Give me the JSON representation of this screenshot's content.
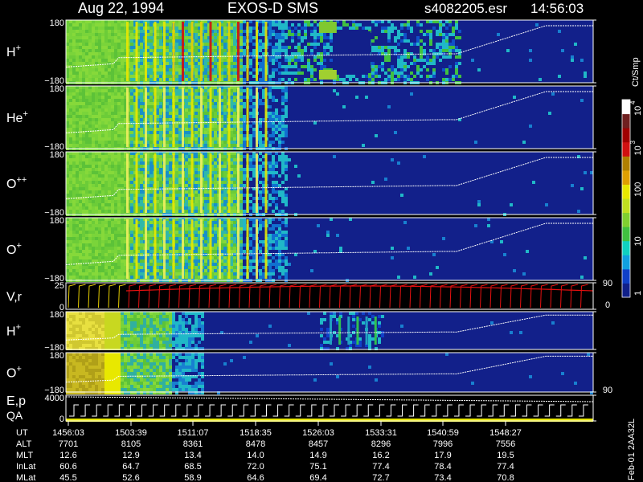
{
  "header": {
    "date": "Aug 22, 1994",
    "instrument": "EXOS-D SMS",
    "file": "s4082205.esr",
    "time": "14:56:03"
  },
  "colorbar": {
    "unit": "Ct/Smp",
    "tick_labels": [
      "1",
      "10",
      "100",
      "10",
      "3",
      "10",
      "4"
    ],
    "levels_log10": [
      0,
      1,
      2,
      3,
      4
    ],
    "colors": [
      "#10208a",
      "#1040c8",
      "#10a0e0",
      "#10d0c0",
      "#40c040",
      "#80d030",
      "#c0e020",
      "#e8e800",
      "#e0a000",
      "#b08000",
      "#d01010",
      "#a00000",
      "#702020",
      "#ffffff"
    ]
  },
  "panels": [
    {
      "label": "H",
      "charge": "+",
      "ytop": "180",
      "ybottom": "−180"
    },
    {
      "label": "He",
      "charge": "+",
      "ytop": "180",
      "ybottom": "−180"
    },
    {
      "label": "O",
      "charge": "++",
      "ytop": "180",
      "ybottom": "−180"
    },
    {
      "label": "O",
      "charge": "+",
      "ytop": "180",
      "ybottom": "−180"
    },
    {
      "label": "V,r",
      "charge": "",
      "ytop": "25",
      "ybottom": "0",
      "right_top": "90",
      "right_bottom": "0"
    },
    {
      "label": "H",
      "charge": "+",
      "ytop": "180",
      "ybottom": "−180"
    },
    {
      "label": "O",
      "charge": "+",
      "ytop": "180",
      "ybottom": "−180",
      "right_bottom": "90"
    },
    {
      "label": "E,p",
      "label2": "QA",
      "charge": "",
      "ytop": "4000",
      "ybottom": "0"
    }
  ],
  "side_note": "Feb-01 2AA32L",
  "orbit_table": {
    "rows": [
      {
        "name": "UT",
        "values": [
          "1456:03",
          "1503:39",
          "1511:07",
          "1518:35",
          "1526:03",
          "1533:31",
          "1540:59",
          "1548:27"
        ]
      },
      {
        "name": "ALT",
        "values": [
          "7701",
          "8105",
          "8361",
          "8478",
          "8457",
          "8296",
          "7996",
          "7556"
        ]
      },
      {
        "name": "MLT",
        "values": [
          "12.6",
          "12.9",
          "13.4",
          "14.0",
          "14.9",
          "16.2",
          "17.9",
          "19.5"
        ]
      },
      {
        "name": "InLat",
        "values": [
          "60.6",
          "64.7",
          "68.5",
          "72.0",
          "75.1",
          "77.4",
          "78.4",
          "77.4"
        ]
      },
      {
        "name": "MLat",
        "values": [
          "45.5",
          "52.6",
          "58.9",
          "64.6",
          "69.4",
          "72.7",
          "73.4",
          "70.8"
        ]
      }
    ]
  },
  "chart_data": {
    "type": "heatmap",
    "title": "Aug 22, 1994   EXOS-D SMS",
    "x": [
      "1456:03",
      "1503:39",
      "1511:07",
      "1518:35",
      "1526:03",
      "1533:31",
      "1540:59",
      "1548:27"
    ],
    "series": [
      {
        "name": "H+",
        "ylim": [
          -180,
          180
        ]
      },
      {
        "name": "He+",
        "ylim": [
          -180,
          180
        ]
      },
      {
        "name": "O++",
        "ylim": [
          -180,
          180
        ]
      },
      {
        "name": "O+",
        "ylim": [
          -180,
          180
        ]
      },
      {
        "name": "V,r",
        "ylim": [
          0,
          25
        ]
      },
      {
        "name": "H+",
        "ylim": [
          -180,
          180
        ]
      },
      {
        "name": "O+",
        "ylim": [
          -180,
          180
        ]
      },
      {
        "name": "E,p",
        "ylim": [
          0,
          4000
        ]
      }
    ],
    "colorbar_unit": "Ct/Smp",
    "colorbar_range_log10": [
      0,
      4
    ]
  }
}
